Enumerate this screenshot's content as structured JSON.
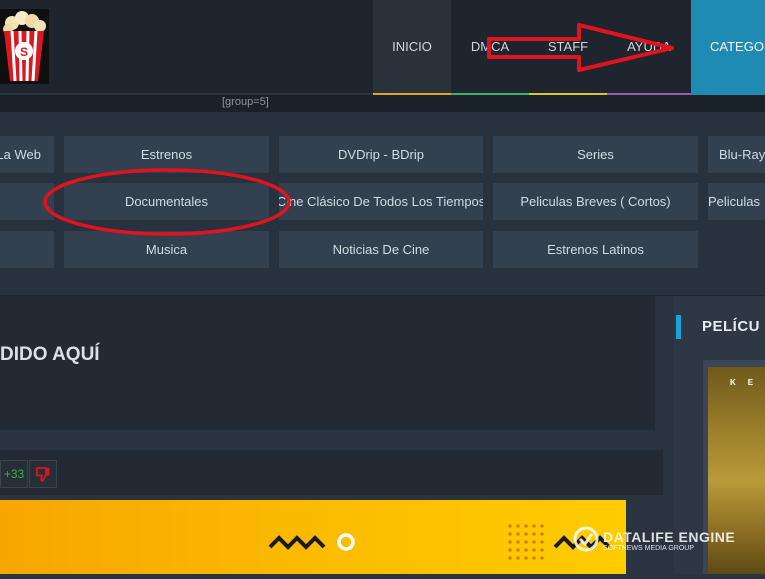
{
  "nav": {
    "items": [
      "INICIO",
      "DMCA",
      "STAFF",
      "AYUDA"
    ],
    "categories_label": "CATEGO"
  },
  "group_label": "[group=5]",
  "categories": {
    "row1": [
      "La Web",
      "Estrenos",
      "DVDrip - BDrip",
      "Series",
      "Blu-Ray"
    ],
    "row2": [
      "Documentales",
      "Cine Clásico De Todos Los Tiempos",
      "Peliculas Breves ( Cortos)",
      "Peliculas"
    ],
    "row3": [
      "Musica",
      "Noticias De Cine",
      "Estrenos Latinos"
    ]
  },
  "main": {
    "headline": "DIDO AQUÍ"
  },
  "rating": {
    "plus": "+33"
  },
  "sidebar": {
    "title": "PELÍCU",
    "poster_text": "KE"
  },
  "watermark": {
    "title": "DATALIFE ENGINE",
    "subtitle": "SOFTNEWS MEDIA GROUP"
  },
  "colors": {
    "accent": "#1f8bb3",
    "annotation": "#e0141e",
    "banner": "#fcbf00"
  },
  "icons": {
    "logo": "popcorn-icon",
    "thumbs_down": "thumbs-down-icon",
    "arrow": "red-arrow-annotation",
    "ellipse": "red-ellipse-annotation"
  }
}
